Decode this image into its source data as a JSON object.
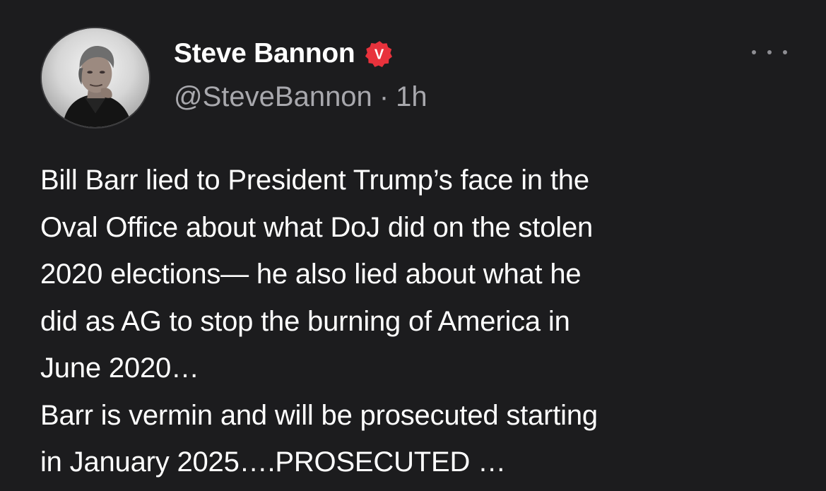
{
  "post": {
    "author": {
      "display_name": "Steve Bannon",
      "handle": "@SteveBannon",
      "separator": "·",
      "time_ago": "1h",
      "verified_badge_letter": "V",
      "verified_badge_color": "#e8323c",
      "avatar_icon": "profile-photo"
    },
    "more_icon": "more-horizontal-icon",
    "body_lines": [
      "Bill Barr lied to President Trump’s face in the",
      "Oval Office about what DoJ did on the stolen",
      "2020 elections— he also lied about what he",
      "did as AG to stop the burning of America in",
      "June 2020…",
      "Barr is vermin and will be prosecuted starting",
      "in January 2025….PROSECUTED …"
    ]
  },
  "colors": {
    "background": "#1c1c1e",
    "primary_text": "#ffffff",
    "secondary_text": "#a8a8ad",
    "more_dots": "#8e8e93"
  }
}
